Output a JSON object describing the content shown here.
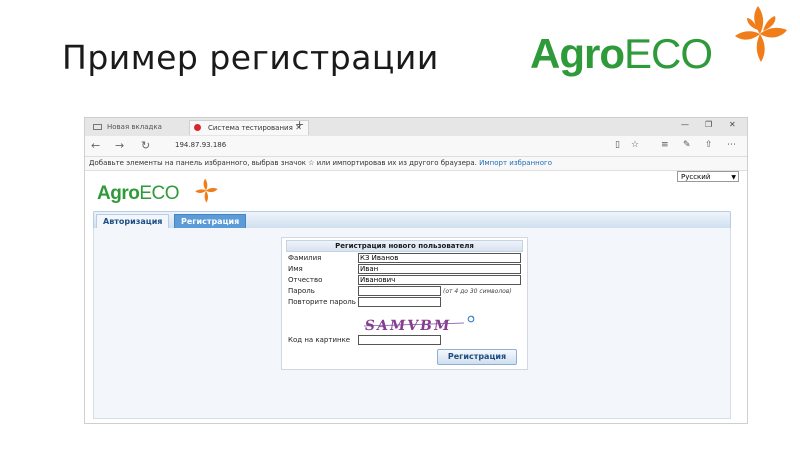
{
  "slide": {
    "title": "Пример регистрации",
    "logo_agro": "Agro",
    "logo_eco": "ECO"
  },
  "colors": {
    "brand_green": "#2e9a3a",
    "leaf_orange": "#f07d1a",
    "tab_active": "#5a9bd8"
  },
  "browser": {
    "tabs": [
      {
        "label": "Новая вкладка",
        "icon": "page-icon"
      },
      {
        "label": "Система тестирования",
        "icon": "opera-icon"
      }
    ],
    "url": "194.87.93.186",
    "favorites_text": "Добавьте элементы на панель избранного, выбрав значок ☆ или импортировав их из другого браузера.",
    "favorites_link": "Импорт избранного"
  },
  "page": {
    "language": "Русский",
    "logo_agro": "Agro",
    "logo_eco": "ECO",
    "tabs": [
      "Авторизация",
      "Регистрация"
    ],
    "form": {
      "title": "Регистрация нового пользователя",
      "fields": [
        {
          "label": "Фамилия",
          "value": "КЗ Иванов"
        },
        {
          "label": "Имя",
          "value": "Иван"
        },
        {
          "label": "Отчество",
          "value": "Иванович"
        },
        {
          "label": "Пароль",
          "value": ""
        },
        {
          "label": "Повторите пароль",
          "value": ""
        }
      ],
      "password_hint": "(от 4 до 30 символов)",
      "captcha_text": "SAMVBM",
      "captcha_label": "Код на картинке",
      "captcha_value": "",
      "submit_label": "Регистрация"
    }
  }
}
